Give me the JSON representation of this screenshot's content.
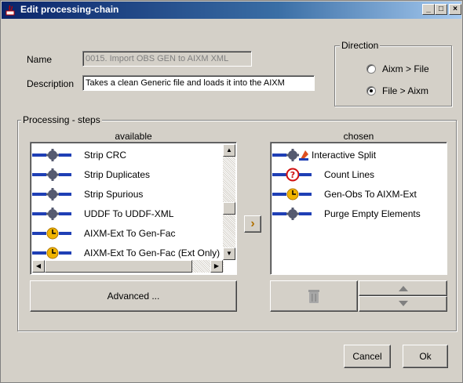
{
  "window": {
    "title": "Edit processing-chain",
    "minimize_glyph": "_",
    "maximize_glyph": "□",
    "close_glyph": "×"
  },
  "form": {
    "name_label": "Name",
    "name_value": "0015. Import OBS GEN to AIXM XML",
    "description_label": "Description",
    "description_value": "Takes a clean Generic file and loads it into the AIXM"
  },
  "direction": {
    "title": "Direction",
    "options": [
      {
        "label": "Aixm > File",
        "selected": false
      },
      {
        "label": "File > Aixm",
        "selected": true
      }
    ]
  },
  "steps": {
    "title": "Processing - steps",
    "available_header": "available",
    "chosen_header": "chosen",
    "available": [
      {
        "label": "Strip CRC",
        "icon": "gear-icon"
      },
      {
        "label": "Strip Duplicates",
        "icon": "gear-icon"
      },
      {
        "label": "Strip Spurious",
        "icon": "gear-icon"
      },
      {
        "label": "UDDF To UDDF-XML",
        "icon": "gear-icon"
      },
      {
        "label": "AIXM-Ext To Gen-Fac",
        "icon": "clock-icon"
      },
      {
        "label": "AIXM-Ext To Gen-Fac (Ext Only)",
        "icon": "clock-icon"
      }
    ],
    "chosen": [
      {
        "label": "Interactive Split",
        "icon": "gear-icon"
      },
      {
        "label": "Count Lines",
        "icon": "question-icon"
      },
      {
        "label": "Gen-Obs To AIXM-Ext",
        "icon": "clock-icon"
      },
      {
        "label": "Purge Empty Elements",
        "icon": "gear-icon"
      }
    ],
    "add_button_glyph": "›",
    "advanced_label": "Advanced ..."
  },
  "footer": {
    "cancel_label": "Cancel",
    "ok_label": "Ok"
  },
  "colors": {
    "titlebar": "#0a246a",
    "face": "#d4d0c8",
    "pipe_blue": "#1f3fb5",
    "clock_yellow": "#f0b400",
    "question_red": "#d01010"
  }
}
